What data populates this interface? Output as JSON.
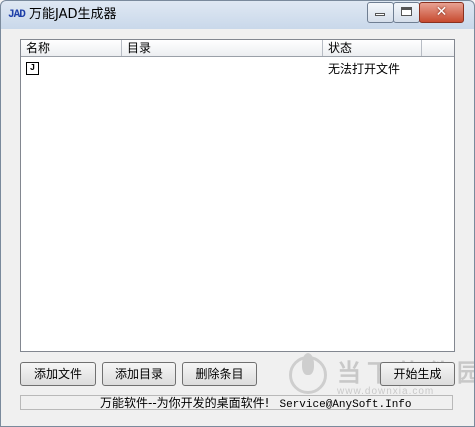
{
  "window": {
    "icon_text": "JAD",
    "title": "万能JAD生成器",
    "close_symbol": "✕"
  },
  "list": {
    "columns": [
      "名称",
      "目录",
      "状态",
      ""
    ],
    "rows": [
      {
        "icon": "J",
        "name": "",
        "dir": "",
        "status": "无法打开文件"
      }
    ]
  },
  "buttons": {
    "add_file": "添加文件",
    "add_dir": "添加目录",
    "delete": "删除条目",
    "start": "开始生成"
  },
  "status_bar": {
    "text": "万能软件--为你开发的桌面软件!",
    "email": "Service@AnySoft.Info"
  },
  "watermark": {
    "main": "当下软件园",
    "sub": "www.downxia.com"
  },
  "icons": [
    "app-icon",
    "minimize-icon",
    "maximize-icon",
    "close-icon",
    "file-icon",
    "watermark-logo-icon"
  ]
}
